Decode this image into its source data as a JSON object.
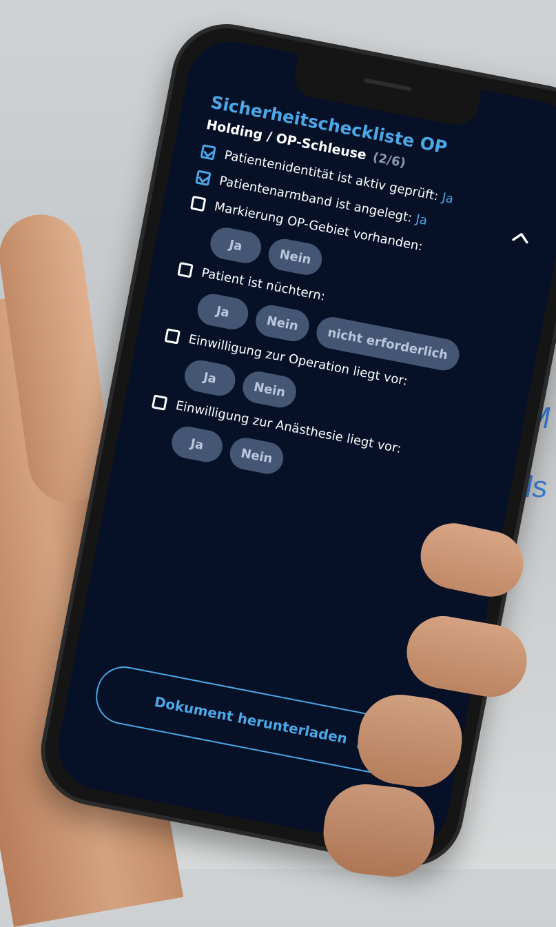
{
  "background": {
    "line1": "M",
    "line2": "als",
    "accent": "#3a7bd5"
  },
  "app": {
    "title": "Sicherheitscheckliste OP",
    "section": {
      "title": "Holding / OP-Schleuse",
      "count": "(2/6)",
      "toggle_icon": "chevron-up-icon"
    },
    "items": [
      {
        "label": "Patientenidentität ist aktiv geprüft:",
        "checked": true,
        "answer": "Ja",
        "options": []
      },
      {
        "label": "Patientenarmband ist angelegt:",
        "checked": true,
        "answer": "Ja",
        "options": []
      },
      {
        "label": "Markierung OP-Gebiet vorhanden:",
        "checked": false,
        "answer": "",
        "options": [
          "Ja",
          "Nein"
        ]
      },
      {
        "label": "Patient ist nüchtern:",
        "checked": false,
        "answer": "",
        "options": [
          "Ja",
          "Nein",
          "nicht erforderlich"
        ]
      },
      {
        "label": "Einwilligung zur Operation liegt vor:",
        "checked": false,
        "answer": "",
        "options": [
          "Ja",
          "Nein"
        ]
      },
      {
        "label": "Einwilligung zur Anästhesie liegt vor:",
        "checked": false,
        "answer": "",
        "options": [
          "Ja",
          "Nein"
        ]
      }
    ],
    "download_label": "Dokument herunterladen",
    "download_icon": "download-icon"
  },
  "colors": {
    "screen_bg": "#061027",
    "accent": "#4da7e6",
    "chip_bg": "#445673",
    "chip_text": "#b9c6dc"
  }
}
